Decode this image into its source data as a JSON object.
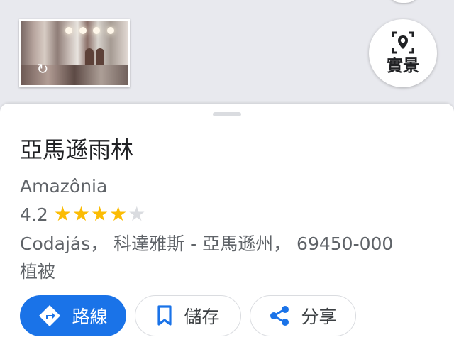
{
  "photo": {
    "icon_name": "360-photo-icon"
  },
  "street_view": {
    "label": "實景",
    "icon_name": "street-view-icon"
  },
  "place": {
    "title": "亞馬遜雨林",
    "subtitle": "Amazônia",
    "rating": "4.2",
    "rating_value": 4.2,
    "stars_max": 5,
    "address": "Codajás， 科達雅斯 - 亞馬遜州， 69450-000",
    "category": "植被"
  },
  "actions": {
    "directions": {
      "label": "路線",
      "icon_name": "directions-icon"
    },
    "save": {
      "label": "儲存",
      "icon_name": "bookmark-icon"
    },
    "share": {
      "label": "分享",
      "icon_name": "share-icon"
    }
  },
  "colors": {
    "accent": "#1a73e8",
    "star": "#fbbc04",
    "secondary_text": "#5f6368",
    "primary_text": "#202124",
    "background": "#e8e9ee"
  }
}
